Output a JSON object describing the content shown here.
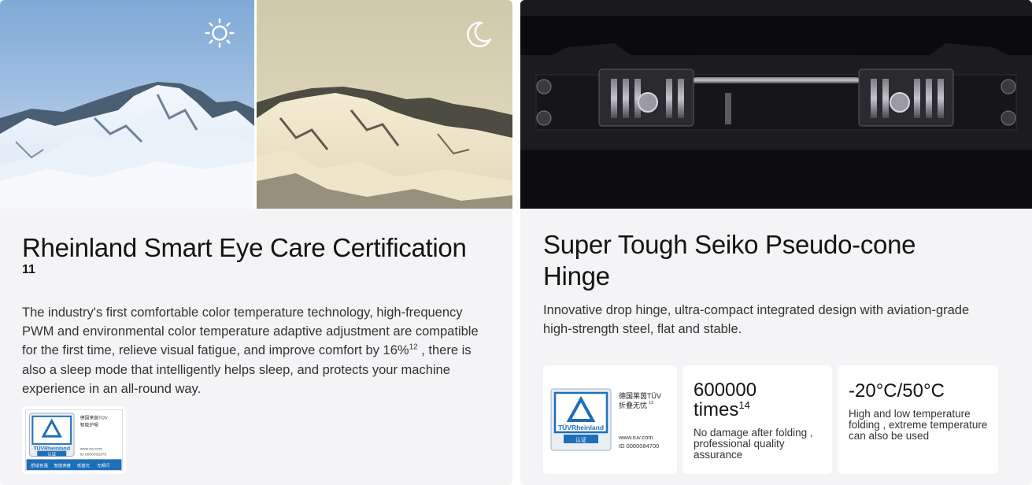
{
  "left_card": {
    "icons": {
      "day": "sun-icon",
      "night": "moon-icon"
    },
    "title": "Rheinland Smart Eye Care Certification",
    "title_sup": "11",
    "body_part1": "The industry's first comfortable color temperature technology, high-frequency PWM and environmental color temperature adaptive adjustment are compatible for the first time, relieve visual fatigue, and improve comfort by 16%",
    "body_sup": "12",
    "body_part2": " , there is also a sleep mode that intelligently helps sleep, and protects your machine experience in an all-round way.",
    "badge": {
      "brand": "TÜVRheinland",
      "stamp": "认证",
      "line1": "德国莱茵TÜV",
      "line2": "智能护眼",
      "url": "www.tuv.com",
      "id": "ID 0000035375",
      "footer": [
        "舒适色温",
        "智能亮度",
        "低蓝光",
        "无频闪"
      ]
    }
  },
  "right_card": {
    "title": "Super Tough Seiko Pseudo-cone Hinge",
    "body": "Innovative drop hinge, ultra-compact integrated design with aviation-grade high-strength steel, flat and stable.",
    "badge": {
      "brand": "TÜVRheinland",
      "stamp": "认证",
      "line1": "德国莱茵TÜV",
      "line2": "折叠无忧",
      "line2_sup": "13",
      "url": "www.tuv.com",
      "id": "ID 0000084700"
    },
    "stat1": {
      "value": "600000",
      "unit": "times",
      "sup": "14",
      "desc": "No damage after folding , professional quality assurance"
    },
    "stat2": {
      "value": "-20°C/50°C",
      "desc": "High and low temperature folding , extreme temperature can also be used"
    }
  },
  "colors": {
    "card_bg": "#f4f4f6",
    "tuv_blue": "#1f6fb8",
    "text": "#141414"
  }
}
